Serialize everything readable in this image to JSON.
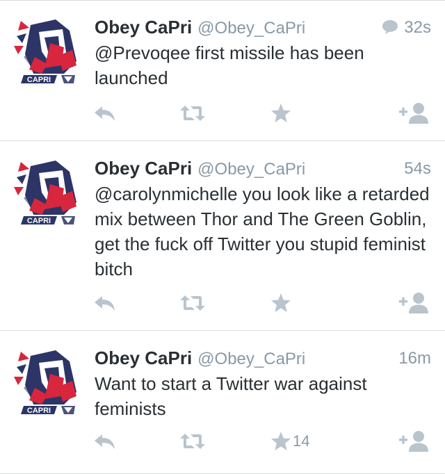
{
  "tweets": [
    {
      "display_name": "Obey CaPri",
      "handle": "@Obey_CaPri",
      "time": "32s",
      "has_reply_badge": true,
      "text": "@Prevoqee first missile has been launched",
      "favorite_count": "",
      "avatar_label": "CAPRI"
    },
    {
      "display_name": "Obey CaPri",
      "handle": "@Obey_CaPri",
      "time": "54s",
      "has_reply_badge": false,
      "text": "@carolynmichelle you look like a retarded mix between Thor and The Green Goblin, get the fuck off Twitter you stupid feminist bitch",
      "favorite_count": "",
      "avatar_label": "CAPRI"
    },
    {
      "display_name": "Obey CaPri",
      "handle": "@Obey_CaPri",
      "time": "16m",
      "has_reply_badge": false,
      "text": "Want to start a Twitter war against feminists",
      "favorite_count": "14",
      "avatar_label": "CAPRI"
    }
  ],
  "icons": {
    "reply": "reply-icon",
    "retweet": "retweet-icon",
    "favorite": "star-icon",
    "follow": "follow-icon",
    "reply_badge": "speech-bubble-icon"
  },
  "colors": {
    "name": "#292f33",
    "meta": "#8899a6",
    "icon": "#b9c4cd",
    "divider": "#d8dde2",
    "avatar_navy": "#2c3566",
    "avatar_red": "#d7263d"
  }
}
